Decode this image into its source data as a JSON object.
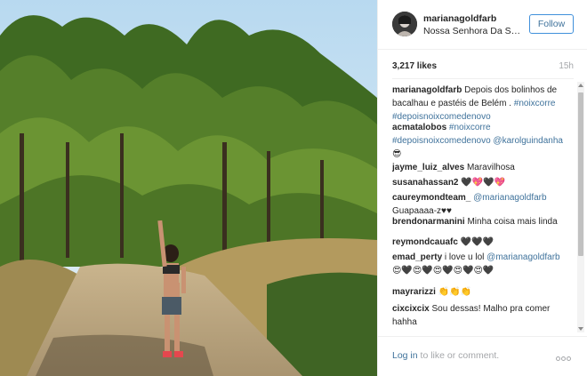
{
  "post": {
    "username": "marianagoldfarb",
    "location": "Nossa Senhora Da Saúde",
    "follow_label": "Follow",
    "likes": "3,217 likes",
    "time": "15h"
  },
  "comments": [
    {
      "user": "marianagoldfarb",
      "parts": [
        {
          "t": "Depois dos bolinhos de bacalhau e pastéis de Belém . "
        },
        {
          "t": "#noixcorre",
          "tag": true
        },
        {
          "t": " "
        },
        {
          "t": "#depoisnoixcomedenovo",
          "tag": true
        }
      ]
    },
    {
      "user": "acmatalobos",
      "parts": [
        {
          "t": "#noixcorre",
          "tag": true
        },
        {
          "t": " "
        },
        {
          "t": "#depoisnoixcomedenovo",
          "tag": true
        },
        {
          "t": " "
        },
        {
          "t": "@karolguindanha",
          "tag": true
        },
        {
          "t": " 😎"
        }
      ]
    },
    {
      "user": "jayme_luiz_alves",
      "parts": [
        {
          "t": "Maravilhosa"
        }
      ]
    },
    {
      "user": "susanahassan2",
      "parts": [
        {
          "t": "🖤💖🖤💖"
        }
      ]
    },
    {
      "user": "caureymondteam_",
      "parts": [
        {
          "t": "@marianagoldfarb",
          "tag": true
        },
        {
          "t": " Guapaaaa-z♥♥"
        }
      ]
    },
    {
      "user": "brendonarmanini",
      "parts": [
        {
          "t": "Minha coisa mais linda"
        }
      ]
    },
    {
      "user": "reymondcauafc",
      "parts": [
        {
          "t": "🖤🖤🖤"
        }
      ]
    },
    {
      "user": "emad_perty",
      "parts": [
        {
          "t": "i love u lol "
        },
        {
          "t": "@marianagoldfarb",
          "tag": true
        },
        {
          "t": " 😍🖤😍🖤😍🖤😍🖤😍🖤"
        }
      ]
    },
    {
      "user": "mayrarizzi",
      "parts": [
        {
          "t": "👏👏👏"
        }
      ]
    },
    {
      "user": "cixcixcix",
      "parts": [
        {
          "t": "Sou dessas! Malho pra comer hahha"
        }
      ]
    }
  ],
  "footer": {
    "login_link": "Log in",
    "login_rest": " to like or comment."
  },
  "icons": {
    "more": "more-options-icon",
    "avatar": "profile-avatar"
  },
  "colors": {
    "link": "#3f729b",
    "follow_border": "#4090db",
    "muted": "#a5a7aa"
  }
}
